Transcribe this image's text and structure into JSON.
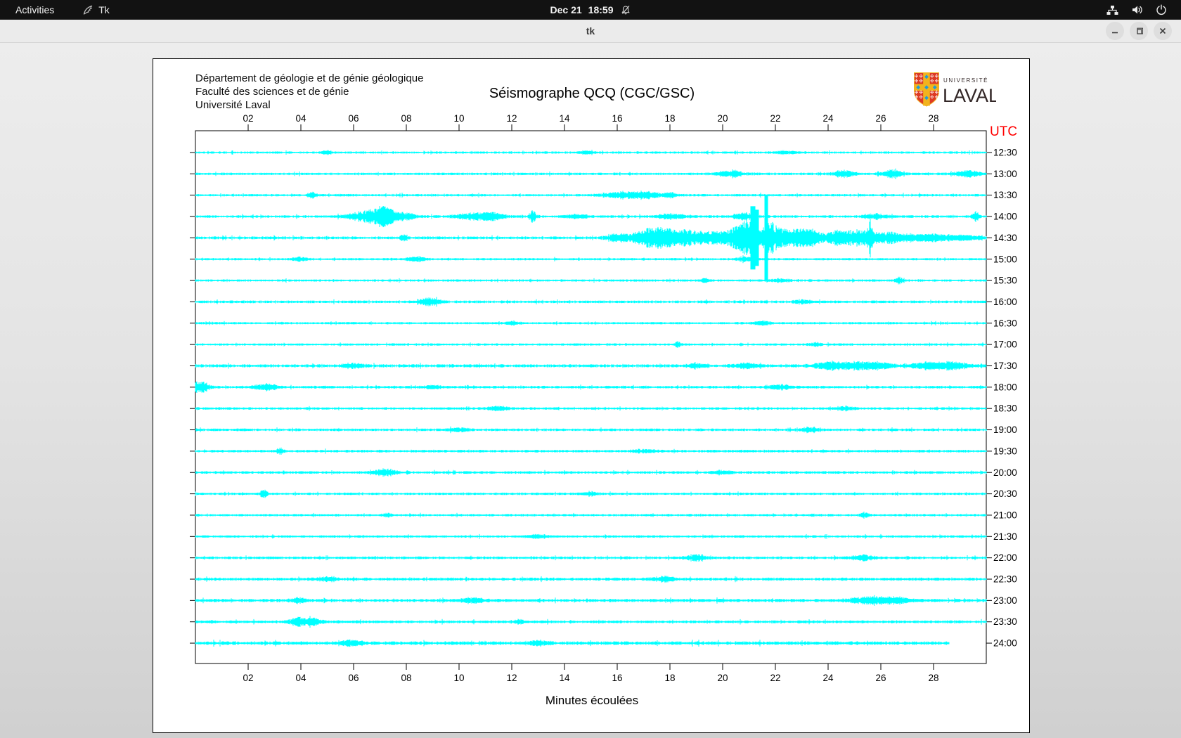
{
  "top_bar": {
    "activities_label": "Activities",
    "app_name": "Tk",
    "clock_date": "Dec 21",
    "clock_time": "18:59",
    "icons": [
      "tk-feather-icon",
      "notifications-off-icon",
      "network-icon",
      "volume-icon",
      "power-icon"
    ]
  },
  "title_bar": {
    "title": "tk",
    "buttons": [
      "minimize",
      "maximize",
      "close"
    ]
  },
  "canvas": {
    "header_lines": [
      "Département de géologie et de génie géologique",
      "Faculté des sciences et de génie",
      "Université Laval"
    ],
    "title": "Séismographe QCQ (CGC/GSC)",
    "logo": {
      "line1": "UNIVERSITÉ",
      "line2": "LAVAL",
      "shield_red": "#dd3a24",
      "shield_gold": "#f2b31e",
      "shield_blue": "#1f9dd9",
      "text_color": "#322626"
    },
    "utc_label": "UTC",
    "xlabel": "Minutes écoulées"
  },
  "chart_data": {
    "type": "seismogram-helicorder",
    "station": "QCQ (CGC/GSC)",
    "title": "Séismographe QCQ (CGC/GSC)",
    "xlabel": "Minutes écoulées",
    "x_range_minutes": [
      0,
      30
    ],
    "x_ticks": [
      "02",
      "04",
      "06",
      "08",
      "10",
      "12",
      "14",
      "16",
      "18",
      "20",
      "22",
      "24",
      "26",
      "28"
    ],
    "trace_color": "#00ffff",
    "utc_axis_color": "#ff0000",
    "rows": [
      {
        "utc": "12:30",
        "base": 1.3,
        "events": [
          {
            "m": 5.0,
            "w": 0.15,
            "a": 2.2
          },
          {
            "m": 14.9,
            "w": 0.2,
            "a": 2.4
          },
          {
            "m": 22.4,
            "w": 0.3,
            "a": 1.8
          }
        ]
      },
      {
        "utc": "13:00",
        "base": 1.4,
        "events": [
          {
            "m": 20.3,
            "w": 0.35,
            "a": 4.5
          },
          {
            "m": 24.6,
            "w": 0.28,
            "a": 5
          },
          {
            "m": 26.4,
            "w": 0.28,
            "a": 5
          },
          {
            "m": 29.3,
            "w": 0.35,
            "a": 4
          }
        ]
      },
      {
        "utc": "13:30",
        "base": 1.4,
        "events": [
          {
            "m": 4.4,
            "w": 0.1,
            "a": 4
          },
          {
            "m": 16.2,
            "w": 0.5,
            "a": 4.2
          },
          {
            "m": 17.1,
            "w": 0.35,
            "a": 3.8
          },
          {
            "m": 18.0,
            "w": 0.2,
            "a": 2.8
          }
        ]
      },
      {
        "utc": "14:00",
        "base": 1.5,
        "events": [
          {
            "m": 6.6,
            "w": 0.5,
            "a": 8
          },
          {
            "m": 7.2,
            "w": 0.28,
            "a": 11
          },
          {
            "m": 8.0,
            "w": 0.3,
            "a": 4
          },
          {
            "m": 10.6,
            "w": 0.5,
            "a": 4
          },
          {
            "m": 11.3,
            "w": 0.3,
            "a": 3.5
          },
          {
            "m": 12.8,
            "w": 0.1,
            "a": 7
          },
          {
            "m": 14.5,
            "w": 0.3,
            "a": 2.5
          },
          {
            "m": 18.1,
            "w": 0.4,
            "a": 3
          },
          {
            "m": 20.8,
            "w": 0.3,
            "a": 4
          },
          {
            "m": 25.8,
            "w": 0.3,
            "a": 3
          },
          {
            "m": 29.6,
            "w": 0.1,
            "a": 7
          }
        ]
      },
      {
        "utc": "14:30",
        "base": 1.6,
        "events": [
          {
            "m": 7.9,
            "w": 0.12,
            "a": 3
          },
          {
            "m": 16.0,
            "w": 0.3,
            "a": 5
          },
          {
            "m": 17.3,
            "w": 0.5,
            "a": 12
          },
          {
            "m": 17.9,
            "w": 0.3,
            "a": 6
          },
          {
            "m": 18.6,
            "w": 0.4,
            "a": 10
          },
          {
            "m": 19.5,
            "w": 0.3,
            "a": 7
          },
          {
            "m": 20.4,
            "w": 0.4,
            "a": 12
          },
          {
            "m": 21.0,
            "w": 0.25,
            "a": 22
          },
          {
            "m": 21.15,
            "w": 0.1,
            "a": 45,
            "clip": true
          },
          {
            "m": 21.3,
            "w": 0.08,
            "a": 40,
            "clip": true
          },
          {
            "m": 21.65,
            "w": 0.07,
            "a": 60,
            "clip": true
          },
          {
            "m": 21.75,
            "w": 0.2,
            "a": 18
          },
          {
            "m": 22.2,
            "w": 0.4,
            "a": 11
          },
          {
            "m": 22.9,
            "w": 0.3,
            "a": 8
          },
          {
            "m": 23.4,
            "w": 0.3,
            "a": 10
          },
          {
            "m": 24.3,
            "w": 0.25,
            "a": 8
          },
          {
            "m": 25.2,
            "w": 0.5,
            "a": 11
          },
          {
            "m": 25.6,
            "w": 0.07,
            "a": 18
          },
          {
            "m": 26.3,
            "w": 0.3,
            "a": 6
          },
          {
            "m": 27.2,
            "w": 0.5,
            "a": 4
          },
          {
            "m": 28.2,
            "w": 0.6,
            "a": 3
          },
          {
            "m": 29.2,
            "w": 0.5,
            "a": 2.5
          }
        ]
      },
      {
        "utc": "15:00",
        "base": 1.3,
        "events": [
          {
            "m": 4.0,
            "w": 0.2,
            "a": 2.8
          },
          {
            "m": 8.4,
            "w": 0.25,
            "a": 3
          },
          {
            "m": 20.9,
            "w": 0.3,
            "a": 2.5
          }
        ]
      },
      {
        "utc": "15:30",
        "base": 1.3,
        "events": [
          {
            "m": 19.3,
            "w": 0.12,
            "a": 2.8
          },
          {
            "m": 22.2,
            "w": 0.25,
            "a": 2.2
          },
          {
            "m": 26.7,
            "w": 0.1,
            "a": 4
          }
        ]
      },
      {
        "utc": "16:00",
        "base": 1.5,
        "events": [
          {
            "m": 8.9,
            "w": 0.3,
            "a": 4.5
          },
          {
            "m": 23.0,
            "w": 0.2,
            "a": 2.4
          }
        ]
      },
      {
        "utc": "16:30",
        "base": 1.3,
        "events": [
          {
            "m": 12.0,
            "w": 0.2,
            "a": 2
          },
          {
            "m": 21.5,
            "w": 0.2,
            "a": 2.4
          }
        ]
      },
      {
        "utc": "17:00",
        "base": 1.3,
        "events": [
          {
            "m": 18.3,
            "w": 0.1,
            "a": 3.5
          },
          {
            "m": 23.5,
            "w": 0.2,
            "a": 2.4
          }
        ]
      },
      {
        "utc": "17:30",
        "base": 1.8,
        "events": [
          {
            "m": 6.0,
            "w": 0.3,
            "a": 2.4
          },
          {
            "m": 19.0,
            "w": 0.2,
            "a": 3
          },
          {
            "m": 20.9,
            "w": 0.3,
            "a": 3
          },
          {
            "m": 24.0,
            "w": 0.4,
            "a": 4
          },
          {
            "m": 25.1,
            "w": 0.5,
            "a": 4.4
          },
          {
            "m": 26.0,
            "w": 0.3,
            "a": 3.5
          },
          {
            "m": 27.8,
            "w": 0.5,
            "a": 4
          },
          {
            "m": 28.8,
            "w": 0.35,
            "a": 4
          }
        ]
      },
      {
        "utc": "18:00",
        "base": 1.5,
        "events": [
          {
            "m": 0.15,
            "w": 0.25,
            "a": 7
          },
          {
            "m": 2.7,
            "w": 0.3,
            "a": 4
          },
          {
            "m": 9.0,
            "w": 0.2,
            "a": 2.4
          },
          {
            "m": 22.2,
            "w": 0.3,
            "a": 2.8
          }
        ]
      },
      {
        "utc": "18:30",
        "base": 1.4,
        "events": [
          {
            "m": 11.5,
            "w": 0.25,
            "a": 3
          },
          {
            "m": 24.7,
            "w": 0.2,
            "a": 2.8
          }
        ]
      },
      {
        "utc": "19:00",
        "base": 1.5,
        "events": [
          {
            "m": 10.0,
            "w": 0.3,
            "a": 2
          },
          {
            "m": 23.3,
            "w": 0.25,
            "a": 2.5
          }
        ]
      },
      {
        "utc": "19:30",
        "base": 1.5,
        "events": [
          {
            "m": 3.2,
            "w": 0.1,
            "a": 4
          },
          {
            "m": 17.0,
            "w": 0.3,
            "a": 2
          }
        ]
      },
      {
        "utc": "20:00",
        "base": 1.5,
        "events": [
          {
            "m": 7.2,
            "w": 0.3,
            "a": 4.5
          },
          {
            "m": 20.0,
            "w": 0.25,
            "a": 2.4
          }
        ]
      },
      {
        "utc": "20:30",
        "base": 1.4,
        "events": [
          {
            "m": 2.6,
            "w": 0.1,
            "a": 5
          },
          {
            "m": 15.0,
            "w": 0.2,
            "a": 2
          }
        ]
      },
      {
        "utc": "21:00",
        "base": 1.4,
        "events": [
          {
            "m": 7.3,
            "w": 0.12,
            "a": 2.5
          },
          {
            "m": 25.4,
            "w": 0.12,
            "a": 2.5
          }
        ]
      },
      {
        "utc": "21:30",
        "base": 1.4,
        "events": [
          {
            "m": 13.0,
            "w": 0.3,
            "a": 2.2
          }
        ]
      },
      {
        "utc": "22:00",
        "base": 1.5,
        "events": [
          {
            "m": 19.0,
            "w": 0.3,
            "a": 4
          },
          {
            "m": 25.3,
            "w": 0.3,
            "a": 3.5
          }
        ]
      },
      {
        "utc": "22:30",
        "base": 1.7,
        "events": [
          {
            "m": 5.0,
            "w": 0.3,
            "a": 2.2
          },
          {
            "m": 17.8,
            "w": 0.3,
            "a": 3
          }
        ]
      },
      {
        "utc": "23:00",
        "base": 1.8,
        "events": [
          {
            "m": 3.9,
            "w": 0.2,
            "a": 3
          },
          {
            "m": 10.5,
            "w": 0.3,
            "a": 3
          },
          {
            "m": 25.6,
            "w": 0.55,
            "a": 4.5
          },
          {
            "m": 26.6,
            "w": 0.3,
            "a": 3.5
          }
        ]
      },
      {
        "utc": "23:30",
        "base": 1.6,
        "events": [
          {
            "m": 4.0,
            "w": 0.3,
            "a": 5
          },
          {
            "m": 4.5,
            "w": 0.2,
            "a": 4
          },
          {
            "m": 12.3,
            "w": 0.12,
            "a": 3
          }
        ]
      },
      {
        "utc": "24:00",
        "base": 2.0,
        "end_min": 28.6,
        "events": [
          {
            "m": 5.9,
            "w": 0.3,
            "a": 3.5
          },
          {
            "m": 13.0,
            "w": 0.3,
            "a": 2.5
          }
        ]
      }
    ]
  }
}
